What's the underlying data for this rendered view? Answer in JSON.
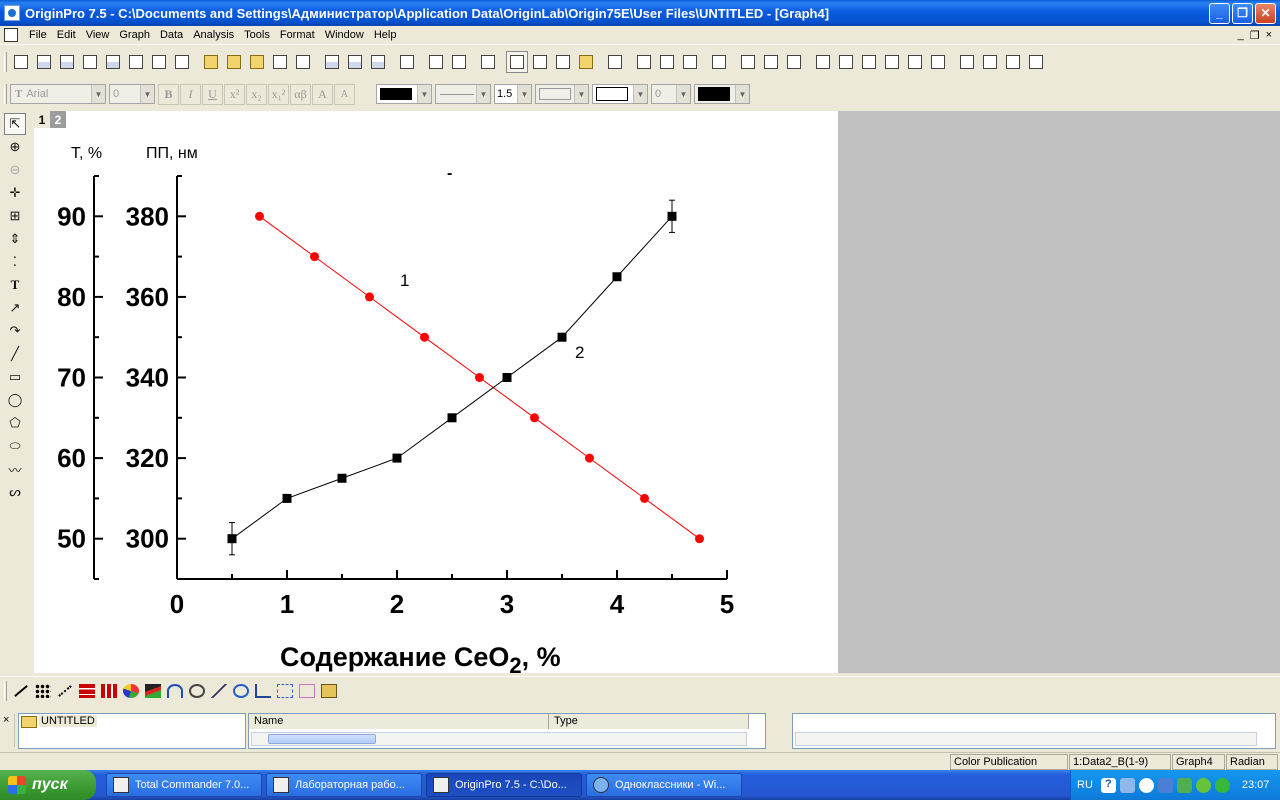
{
  "window": {
    "title": "OriginPro 7.5 - C:\\Documents and Settings\\Администратор\\Application Data\\OriginLab\\Origin75E\\User Files\\UNTITLED - [Graph4]",
    "controls": [
      "_",
      "❐",
      "✕"
    ]
  },
  "menu": {
    "items": [
      "File",
      "Edit",
      "View",
      "Graph",
      "Data",
      "Analysis",
      "Tools",
      "Format",
      "Window",
      "Help"
    ],
    "mdi_controls": [
      "_",
      "❐",
      "×"
    ]
  },
  "format_toolbar": {
    "font": "Arial",
    "font_size": "0",
    "line_width": "1.5",
    "symbol_size": "0",
    "text_buttons": [
      "B",
      "I",
      "U",
      "x²",
      "x₂",
      "x₁²",
      "αβ",
      "A",
      "A"
    ]
  },
  "layer_tabs": [
    "1",
    "2"
  ],
  "graph": {
    "y1_title": "T, %",
    "y2_title": "ПП, нм",
    "x_title_main": "Содержание CeO",
    "x_title_sub": "2",
    "x_title_tail": ", %",
    "curve_labels": [
      "1",
      "2"
    ],
    "top_mark": "-"
  },
  "chart_data": {
    "type": "scatter",
    "title": "",
    "xlabel": "Содержание CeO2, %",
    "xlim": [
      0,
      5
    ],
    "x_ticks": [
      0,
      1,
      2,
      3,
      4,
      5
    ],
    "axes": [
      {
        "name": "T, %",
        "position": "left-outer",
        "lim": [
          45,
          95
        ],
        "ticks": [
          50,
          60,
          70,
          80,
          90
        ]
      },
      {
        "name": "ПП, нм",
        "position": "left-inner",
        "lim": [
          290,
          390
        ],
        "ticks": [
          300,
          320,
          340,
          360,
          380
        ]
      }
    ],
    "grid": false,
    "legend": "none",
    "series": [
      {
        "name": "1",
        "color": "#ff0000",
        "marker": "circle",
        "axis": "ПП, нм",
        "x": [
          0.75,
          1.25,
          1.75,
          2.25,
          2.75,
          3.25,
          3.75,
          4.25,
          4.75
        ],
        "y": [
          380,
          370,
          360,
          350,
          340,
          330,
          320,
          310,
          300
        ]
      },
      {
        "name": "2",
        "color": "#000000",
        "marker": "square",
        "axis": "ПП, нм",
        "x": [
          0.5,
          1.0,
          1.5,
          2.0,
          2.5,
          3.0,
          3.5,
          4.0,
          4.5
        ],
        "y": [
          300,
          310,
          315,
          320,
          330,
          340,
          350,
          365,
          380
        ],
        "error_bars": [
          {
            "x": 0.5,
            "err": 4
          },
          {
            "x": 4.5,
            "err": 4
          }
        ]
      }
    ]
  },
  "explorer": {
    "folder": "UNTITLED",
    "columns": [
      "Name",
      "Type"
    ]
  },
  "status": {
    "cells": [
      "Color Publication",
      "1:Data2_B(1-9)",
      "Graph4",
      "Radian"
    ]
  },
  "taskbar": {
    "start_label": "пуск",
    "tasks": [
      "Total Commander 7.0...",
      "Лабораторная рабо...",
      "OriginPro 7.5 - C:\\Do...",
      "Одноклассники - Wi..."
    ],
    "language": "RU",
    "clock": "23:07"
  },
  "colors": {
    "title_bar": "#0a5ae0",
    "series1": "#ff0000",
    "series2": "#000000",
    "workspace_grey": "#c0c0c0"
  }
}
